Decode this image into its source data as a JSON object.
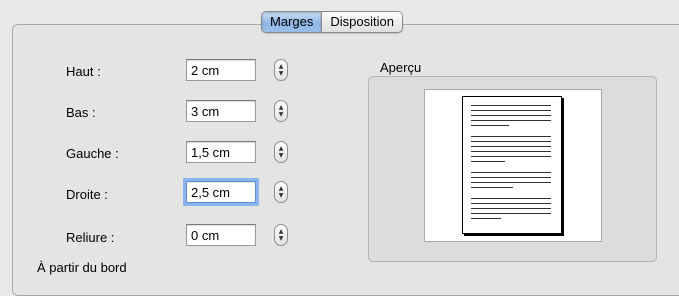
{
  "tabs": [
    {
      "label": "Marges",
      "selected": true
    },
    {
      "label": "Disposition",
      "selected": false
    }
  ],
  "fields": [
    {
      "label": "Haut :",
      "value": "2 cm"
    },
    {
      "label": "Bas :",
      "value": "3 cm"
    },
    {
      "label": "Gauche :",
      "value": "1,5 cm"
    },
    {
      "label": "Droite :",
      "value": "2,5 cm",
      "focused": true
    },
    {
      "label": "Reliure :",
      "value": "0 cm"
    }
  ],
  "stepper_icon": "stepper-up-down-icon",
  "preview": {
    "title": "Aperçu"
  },
  "bottom_label": "À partir du bord",
  "colors": {
    "selected_tab": "#8fb6e4",
    "focus_ring": "#8ab4ec"
  }
}
